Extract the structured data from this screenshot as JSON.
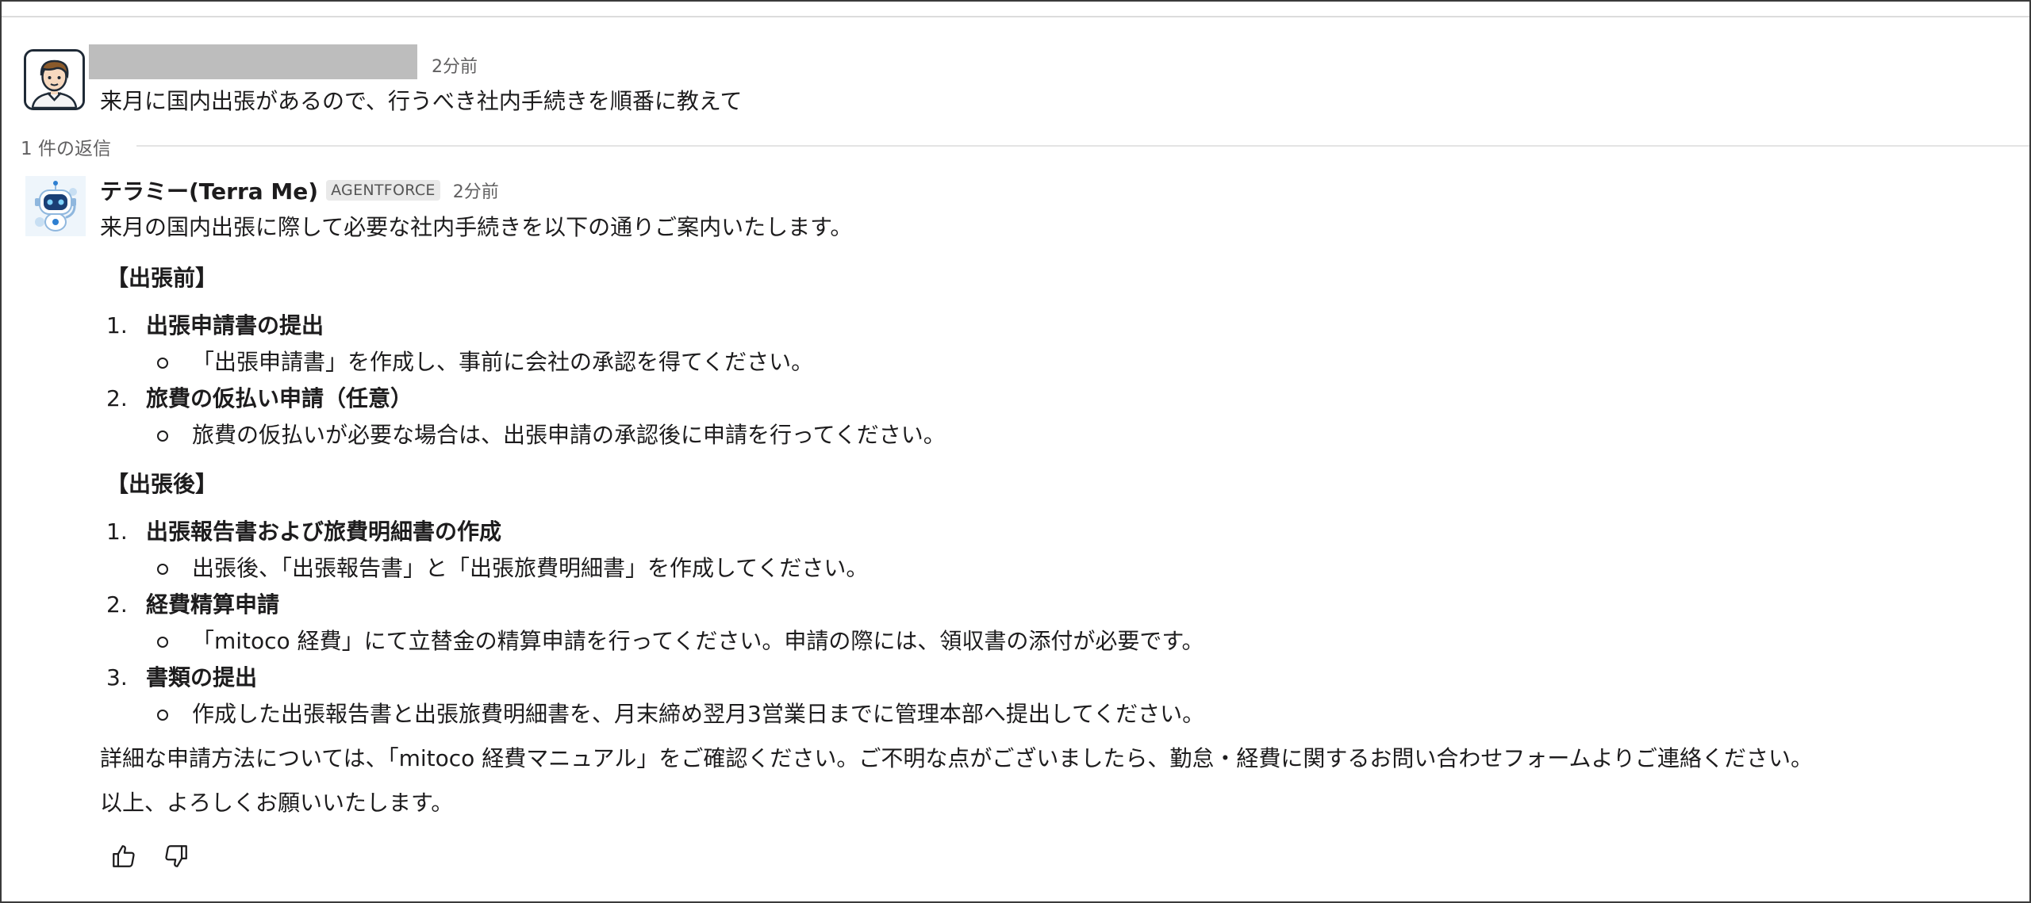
{
  "user_message": {
    "time": "2分前",
    "text": "来月に国内出張があるので、行うべき社内手続きを順番に教えて"
  },
  "thread": {
    "reply_count_label": "1 件の返信"
  },
  "bot_message": {
    "name": "テラミー(Terra Me)",
    "badge": "AGENTFORCE",
    "time": "2分前",
    "intro": "来月の国内出張に際して必要な社内手続きを以下の通りご案内いたします。",
    "sections": [
      {
        "title": "【出張前】",
        "items": [
          {
            "num": "1.",
            "title": "出張申請書の提出",
            "detail": "「出張申請書」を作成し、事前に会社の承認を得てください。"
          },
          {
            "num": "2.",
            "title": "旅費の仮払い申請（任意）",
            "detail": "旅費の仮払いが必要な場合は、出張申請の承認後に申請を行ってください。"
          }
        ]
      },
      {
        "title": "【出張後】",
        "items": [
          {
            "num": "1.",
            "title": "出張報告書および旅費明細書の作成",
            "detail": "出張後、「出張報告書」と「出張旅費明細書」を作成してください。"
          },
          {
            "num": "2.",
            "title": "経費精算申請",
            "detail": "「mitoco 経費」にて立替金の精算申請を行ってください。申請の際には、領収書の添付が必要です。"
          },
          {
            "num": "3.",
            "title": "書類の提出",
            "detail": "作成した出張報告書と出張旅費明細書を、月末締め翌月3営業日までに管理本部へ提出してください。"
          }
        ]
      }
    ],
    "note": "詳細な申請方法については、「mitoco 経費マニュアル」をご確認ください。ご不明な点がございましたら、勤怠・経費に関するお問い合わせフォームよりご連絡ください。",
    "closing": "以上、よろしくお願いいたします。"
  }
}
